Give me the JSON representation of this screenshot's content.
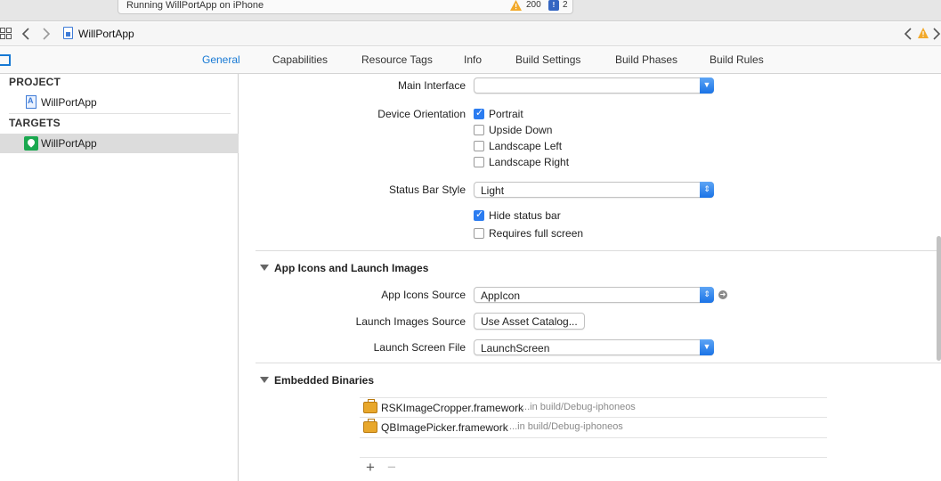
{
  "activity": {
    "status": "Running WillPortApp on iPhone",
    "warnings": "200",
    "issues": "2"
  },
  "jumpbar": {
    "title": "WillPortApp"
  },
  "tabs": [
    "General",
    "Capabilities",
    "Resource Tags",
    "Info",
    "Build Settings",
    "Build Phases",
    "Build Rules"
  ],
  "sidebar": {
    "project_header": "PROJECT",
    "project_item": "WillPortApp",
    "targets_header": "TARGETS",
    "target_item": "WillPortApp"
  },
  "deployment": {
    "main_interface_label": "Main Interface",
    "main_interface_value": "",
    "device_orientation_label": "Device Orientation",
    "orientations": [
      {
        "label": "Portrait",
        "checked": true
      },
      {
        "label": "Upside Down",
        "checked": false
      },
      {
        "label": "Landscape Left",
        "checked": false
      },
      {
        "label": "Landscape Right",
        "checked": false
      }
    ],
    "status_bar_style_label": "Status Bar Style",
    "status_bar_style_value": "Light",
    "hide_status_bar": {
      "label": "Hide status bar",
      "checked": true
    },
    "requires_full_screen": {
      "label": "Requires full screen",
      "checked": false
    }
  },
  "app_icons": {
    "section_title": "App Icons and Launch Images",
    "app_icons_source_label": "App Icons Source",
    "app_icons_source_value": "AppIcon",
    "launch_images_source_label": "Launch Images Source",
    "launch_images_source_button": "Use Asset Catalog...",
    "launch_screen_file_label": "Launch Screen File",
    "launch_screen_file_value": "LaunchScreen"
  },
  "embedded_binaries": {
    "section_title": "Embedded Binaries",
    "items": [
      {
        "name": "RSKImageCropper.framework",
        "path": "...in build/Debug-iphoneos"
      },
      {
        "name": "QBImagePicker.framework",
        "path": "...in build/Debug-iphoneos"
      }
    ],
    "add_label": "+",
    "remove_label": "−"
  },
  "icons": {
    "warning": "warning-triangle-icon",
    "issue": "issue-badge-icon",
    "grid": "grid-icon",
    "back": "chevron-left-icon",
    "forward": "chevron-right-icon",
    "file": "project-file-icon"
  },
  "colors": {
    "accent": "#1779d4",
    "checkbox_on": "#2b7cf0",
    "target_icon": "#1aa84f",
    "framework_icon": "#e8a72b"
  }
}
